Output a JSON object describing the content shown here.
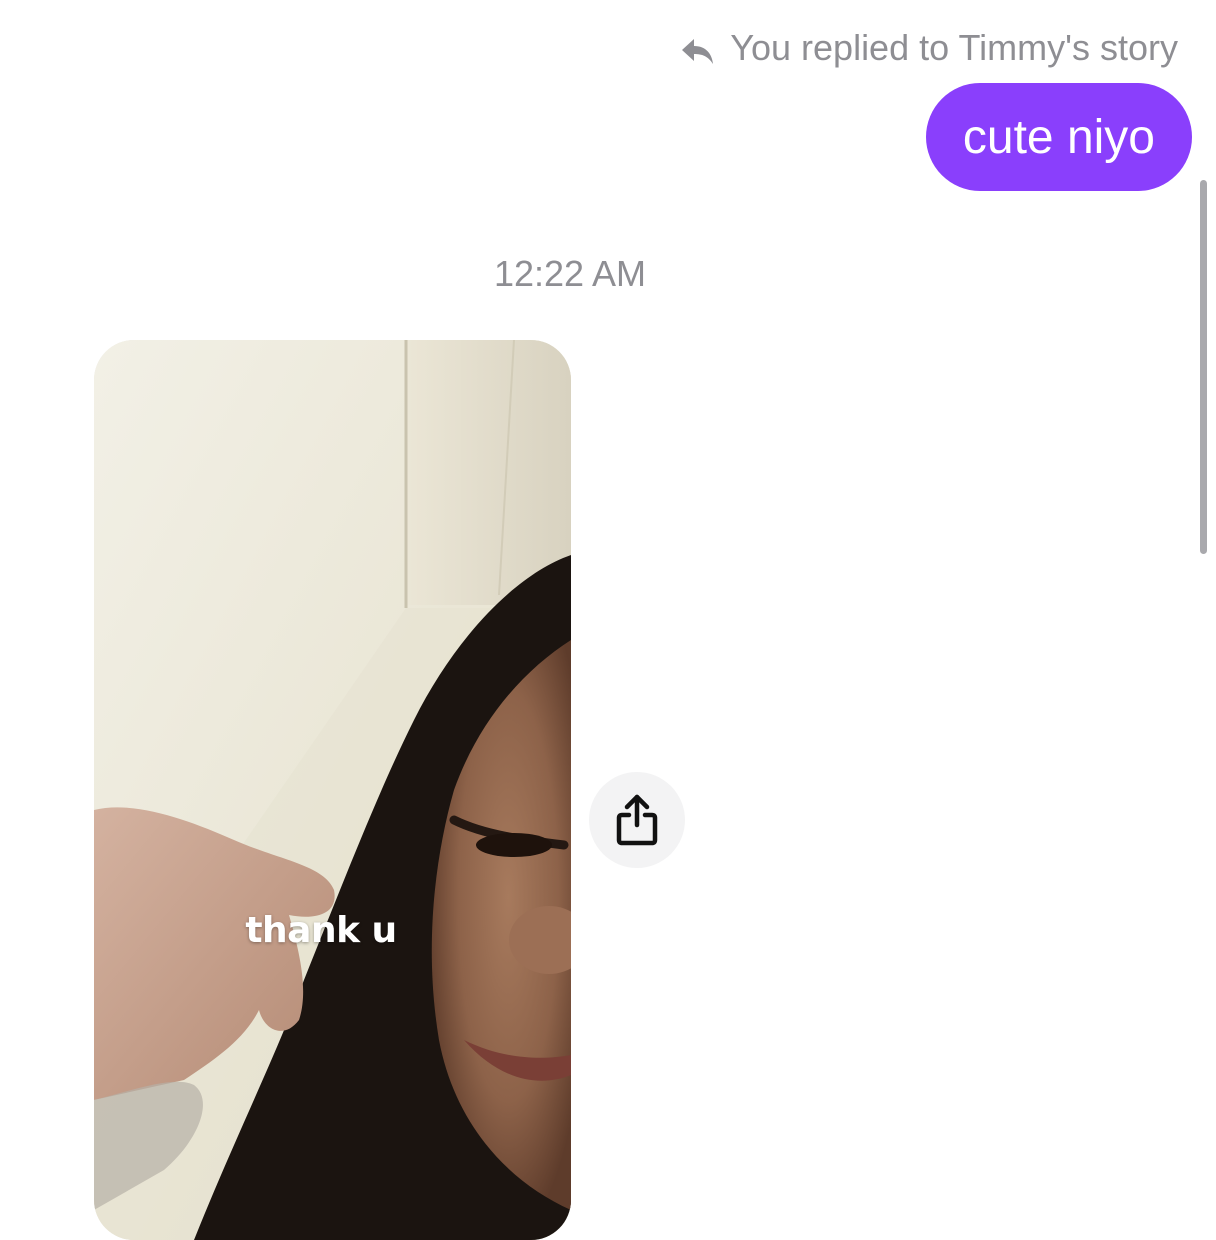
{
  "reply_context": {
    "icon": "reply-arrow-icon",
    "text": "You replied to Timmy's story"
  },
  "outgoing_message": {
    "text": "cute niyo",
    "color": "#8a3ffc"
  },
  "timestamp": "12:22 AM",
  "story": {
    "caption": "thank u"
  },
  "share_button": {
    "icon": "share-icon"
  }
}
